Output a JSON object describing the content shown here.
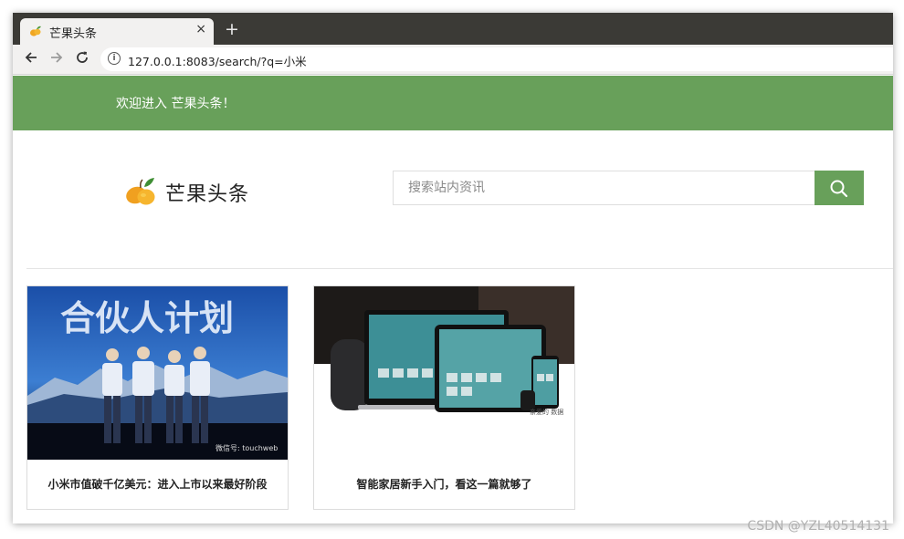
{
  "browser": {
    "tab_title": "芒果头条",
    "tab_close": "×",
    "new_tab": "+",
    "url": "127.0.0.1:8083/search/?q=小米"
  },
  "header": {
    "welcome": "欢迎进入 芒果头条！"
  },
  "brand": {
    "name": "芒果头条",
    "logo": "mango-logo"
  },
  "search": {
    "placeholder": "搜索站内资讯",
    "icon": "search-icon",
    "accent": "#68a05a"
  },
  "results": [
    {
      "title": "小米市值破千亿美元：进入上市以来最好阶段",
      "image_text": "合伙人计划",
      "image_caption": "微信号: touchweb"
    },
    {
      "title": "智能家居新手入门，看这一篇就够了",
      "image_caption": "亲爱的 数据"
    }
  ],
  "watermark": "CSDN @YZL40514131"
}
